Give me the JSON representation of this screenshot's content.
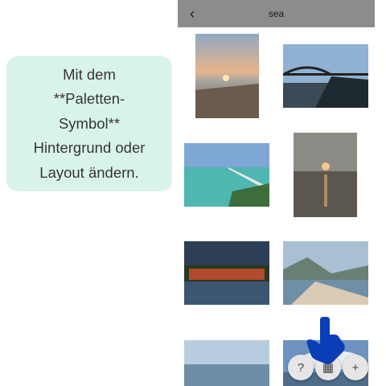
{
  "tutorial": {
    "tip_text": "Mit dem\n**Paletten-\nSymbol**\nHintergrund oder\nLayout ändern."
  },
  "screen": {
    "title": "sea",
    "back_icon": "chevron-left-icon",
    "photos": [
      {
        "icon": "sunset-beach-photo"
      },
      {
        "icon": "bridge-photo"
      },
      {
        "icon": "pier-photo"
      },
      {
        "icon": "sunset-sea-photo"
      },
      {
        "icon": "shrine-photo"
      },
      {
        "icon": "coast-photo"
      },
      {
        "icon": "sea-photo"
      },
      {
        "icon": "cloudy-sea-photo"
      }
    ],
    "fab": {
      "help_glyph": "?",
      "layout_glyph": "▦",
      "add_glyph": "+"
    }
  }
}
